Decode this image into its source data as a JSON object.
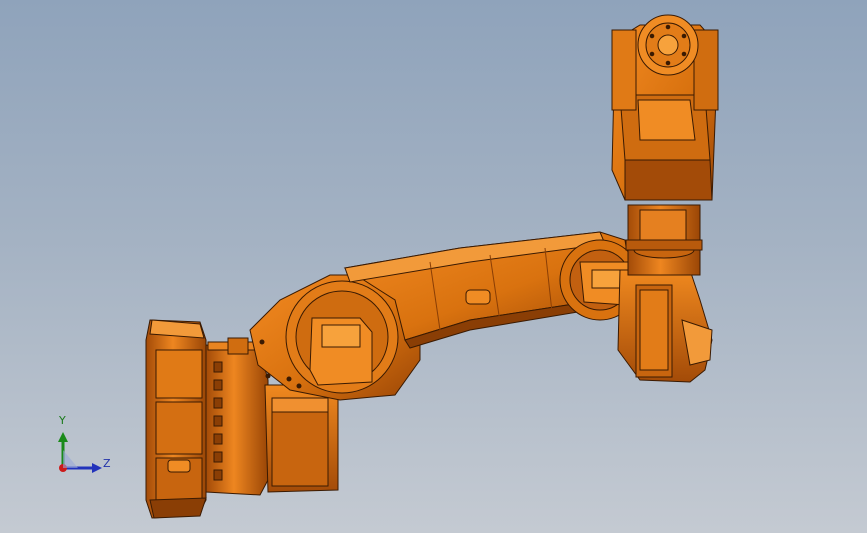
{
  "viewport": {
    "background_top": "#8fa3bb",
    "background_bottom": "#c4cad2"
  },
  "model": {
    "name": "robot-arm",
    "color_main": "#d9720f",
    "color_shadow": "#8a3e05",
    "color_highlight": "#f28a22",
    "color_edge": "#3a1a02"
  },
  "triad": {
    "y_label": "Y",
    "z_label": "Z",
    "y_color": "#1a8a1a",
    "z_color": "#2233bb",
    "x_color": "#cc1a1a"
  }
}
